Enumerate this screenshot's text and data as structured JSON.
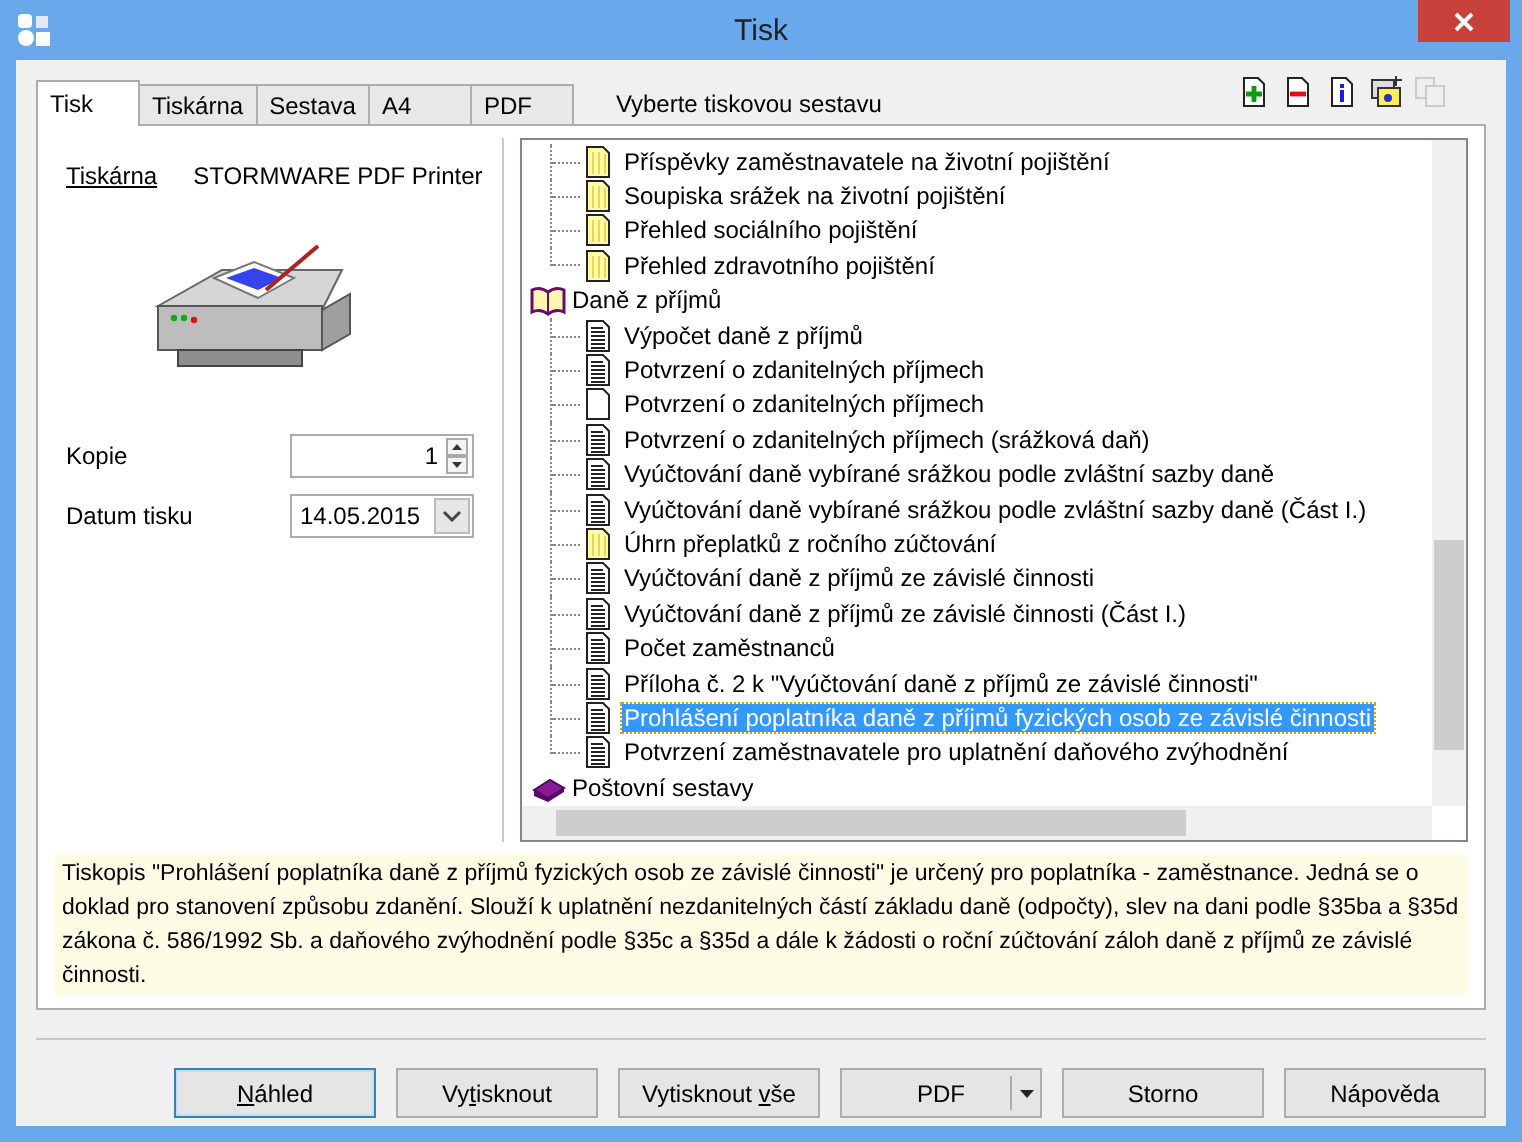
{
  "window": {
    "title": "Tisk"
  },
  "tabs": [
    {
      "label": "Tisk",
      "selected": true
    },
    {
      "label": "Tiskárna",
      "selected": false
    },
    {
      "label": "Sestava",
      "selected": false
    },
    {
      "label": "A4",
      "selected": false
    },
    {
      "label": "PDF",
      "selected": false
    }
  ],
  "tree_heading": "Vyberte tiskovou sestavu",
  "toolbar": [
    {
      "kind": "add",
      "disabled": false
    },
    {
      "kind": "remove",
      "disabled": false
    },
    {
      "kind": "info",
      "disabled": false
    },
    {
      "kind": "new",
      "disabled": false
    },
    {
      "kind": "copy",
      "disabled": true
    }
  ],
  "printer": {
    "label": "Tiskárna",
    "name": "STORMWARE PDF Printer"
  },
  "fields": [
    {
      "kind": "spin",
      "label": "Kopie",
      "value": "1"
    },
    {
      "kind": "date",
      "label": "Datum tisku",
      "value": "14.05.2015"
    }
  ],
  "tree": [
    {
      "kind": "continued",
      "children": [
        {
          "label": "Příspěvky zaměstnavatele na životní pojištění",
          "kind": "yellow",
          "selected": false
        },
        {
          "label": "Soupiska srážek na životní pojištění",
          "kind": "yellow",
          "selected": false
        },
        {
          "label": "Přehled sociálního pojištění",
          "kind": "yellow",
          "selected": false
        },
        {
          "label": "Přehled zdravotního pojištění",
          "kind": "yellow",
          "selected": false
        }
      ]
    },
    {
      "kind": "group",
      "label": "Daně z příjmů",
      "expanded": true,
      "children": [
        {
          "label": "Výpočet daně z příjmů",
          "kind": "lined",
          "selected": false
        },
        {
          "label": "Potvrzení o zdanitelných příjmech",
          "kind": "lined",
          "selected": false
        },
        {
          "label": "Potvrzení o zdanitelných příjmech",
          "kind": "blank",
          "selected": false
        },
        {
          "label": "Potvrzení o zdanitelných příjmech (srážková daň)",
          "kind": "lined",
          "selected": false
        },
        {
          "label": "Vyúčtování daně vybírané srážkou podle zvláštní sazby daně",
          "kind": "lined",
          "selected": false
        },
        {
          "label": "Vyúčtování daně vybírané srážkou podle zvláštní sazby daně (Část I.)",
          "kind": "lined",
          "selected": false
        },
        {
          "label": "Úhrn přeplatků z ročního zúčtování",
          "kind": "yellow",
          "selected": false
        },
        {
          "label": "Vyúčtování daně z příjmů ze závislé činnosti",
          "kind": "lined",
          "selected": false
        },
        {
          "label": "Vyúčtování daně z příjmů ze závislé činnosti (Část I.)",
          "kind": "lined",
          "selected": false
        },
        {
          "label": "Počet zaměstnanců",
          "kind": "lined",
          "selected": false
        },
        {
          "label": "Příloha č. 2 k \"Vyúčtování daně z příjmů ze závislé činnosti\"",
          "kind": "lined",
          "selected": false
        },
        {
          "label": "Prohlášení poplatníka daně z příjmů fyzických osob ze závislé činnosti",
          "kind": "lined",
          "selected": true
        },
        {
          "label": "Potvrzení zaměstnavatele pro uplatnění daňového zvýhodnění",
          "kind": "lined",
          "selected": false
        }
      ]
    },
    {
      "kind": "group",
      "label": "Poštovní sestavy",
      "expanded": false
    }
  ],
  "description": "Tiskopis \"Prohlášení poplatníka daně z příjmů fyzických osob ze závislé činnosti\" je určený pro poplatníka - zaměstnance. Jedná se o doklad pro stanovení způsobu zdanění. Slouží k uplatnění nezdanitelných částí základu daně (odpočty), slev na dani podle §35ba a §35d zákona č. 586/1992 Sb. a daňového zvýhodnění podle §35c a §35d a dále k žádosti o roční zúčtování záloh daně z příjmů ze závislé činnosti.",
  "buttons": [
    {
      "kind": "default",
      "parts": [
        {
          "text": "N",
          "underlined": true
        },
        {
          "text": "áhled",
          "underlined": false
        }
      ]
    },
    {
      "kind": "plain",
      "parts": [
        {
          "text": "Vy",
          "underlined": false
        },
        {
          "text": "t",
          "underlined": true
        },
        {
          "text": "isknout",
          "underlined": false
        }
      ]
    },
    {
      "kind": "plain",
      "parts": [
        {
          "text": "Vytisknout ",
          "underlined": false
        },
        {
          "text": "v",
          "underlined": true
        },
        {
          "text": "še",
          "underlined": false
        }
      ]
    },
    {
      "kind": "split",
      "parts": [
        {
          "text": "PDF",
          "underlined": false
        }
      ]
    },
    {
      "kind": "plain",
      "parts": [
        {
          "text": "Storno",
          "underlined": false
        }
      ]
    },
    {
      "kind": "plain",
      "parts": [
        {
          "text": "Nápověda",
          "underlined": false
        }
      ]
    }
  ]
}
